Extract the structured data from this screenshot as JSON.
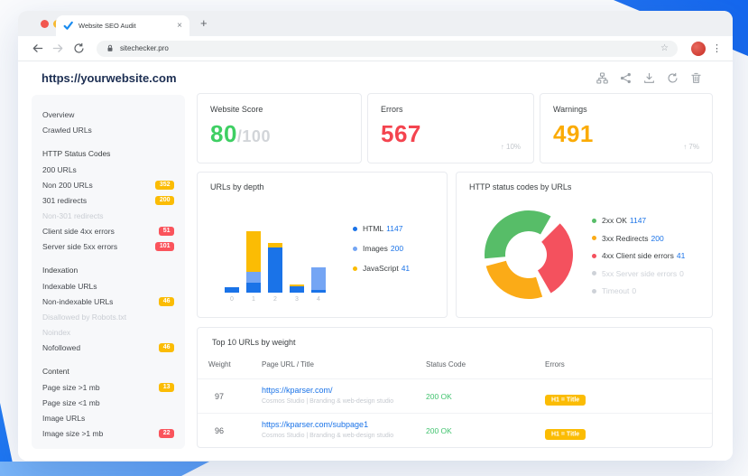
{
  "browser": {
    "tab": {
      "title": "Website SEO Audit",
      "close_icon": "×"
    },
    "new_tab_icon": "+",
    "address": {
      "url": "sitechecker.pro"
    },
    "menu_icon": "⋮"
  },
  "header": {
    "site_url": "https://yourwebsite.com",
    "action_icons": [
      "sitemap-icon",
      "share-icon",
      "download-icon",
      "refresh-icon",
      "trash-icon"
    ]
  },
  "sidebar": {
    "items": [
      {
        "label": "Overview",
        "type": "link"
      },
      {
        "label": "Crawled URLs",
        "type": "link"
      },
      {
        "label": "HTTP Status Codes",
        "type": "header"
      },
      {
        "label": "200 URLs",
        "type": "link"
      },
      {
        "label": "Non 200 URLs",
        "type": "link",
        "badge": "352",
        "badge_color": "orange"
      },
      {
        "label": "301 redirects",
        "type": "link",
        "badge": "200",
        "badge_color": "orange"
      },
      {
        "label": "Non-301 redirects",
        "type": "link",
        "disabled": true
      },
      {
        "label": "Client side 4xx errors",
        "type": "link",
        "badge": "51",
        "badge_color": "red"
      },
      {
        "label": "Server side 5xx errors",
        "type": "link",
        "badge": "101",
        "badge_color": "red"
      },
      {
        "label": "Indexation",
        "type": "header"
      },
      {
        "label": "Indexable URLs",
        "type": "link"
      },
      {
        "label": "Non-indexable URLs",
        "type": "link",
        "badge": "46",
        "badge_color": "orange"
      },
      {
        "label": "Disallowed by Robots.txt",
        "type": "link",
        "disabled": true
      },
      {
        "label": "Noindex",
        "type": "link",
        "disabled": true
      },
      {
        "label": "Nofollowed",
        "type": "link",
        "badge": "46",
        "badge_color": "orange"
      },
      {
        "label": "Content",
        "type": "header"
      },
      {
        "label": "Page size >1 mb",
        "type": "link",
        "badge": "13",
        "badge_color": "orange"
      },
      {
        "label": "Page size <1 mb",
        "type": "link"
      },
      {
        "label": "Image URLs",
        "type": "link"
      },
      {
        "label": "Image size >1 mb",
        "type": "link",
        "badge": "22",
        "badge_color": "red"
      }
    ]
  },
  "stats": {
    "cards": [
      {
        "label": "Website Score",
        "value": "80",
        "suffix": "/100",
        "color": "#3ecf63"
      },
      {
        "label": "Errors",
        "value": "567",
        "delta": "↑ 10%",
        "color": "#f4444f"
      },
      {
        "label": "Warnings",
        "value": "491",
        "delta": "↑ 7%",
        "color": "#fbab05"
      }
    ]
  },
  "chart_data": [
    {
      "type": "bar",
      "stacked": true,
      "title": "URLs by depth",
      "categories": [
        "0",
        "1",
        "2",
        "3",
        "4"
      ],
      "series": [
        {
          "name": "HTML",
          "legend_value": 1147,
          "color": "#1a73e8",
          "values": [
            6,
            11,
            50,
            7,
            3
          ]
        },
        {
          "name": "Images",
          "legend_value": 200,
          "color": "#74a5f4",
          "values": [
            0,
            12,
            0,
            0,
            25
          ]
        },
        {
          "name": "JavaScript",
          "legend_value": 41,
          "color": "#fbbc04",
          "values": [
            0,
            45,
            5,
            2,
            0
          ]
        }
      ],
      "value_unit": "approx px heights (bars carry no numeric labels in UI)",
      "legend_position": "right",
      "x_ticks": [
        "0",
        "1",
        "2",
        "3",
        "4"
      ],
      "grid": false
    },
    {
      "type": "pie",
      "subtype": "donut",
      "title": "HTTP status codes by URLs",
      "segments": [
        {
          "label": "2xx OK",
          "value": 1147,
          "color": "#57bd68"
        },
        {
          "label": "3xx Redirects",
          "value": 200,
          "color": "#fbab17"
        },
        {
          "label": "4xx Client side errors",
          "value": 41,
          "color": "#f4515e"
        },
        {
          "label": "5xx Server side errors",
          "value": 0,
          "color": "#ced2d8"
        },
        {
          "label": "Timeout",
          "value": 0,
          "color": "#ced2d8"
        }
      ],
      "legend_position": "right"
    }
  ],
  "table": {
    "title": "Top 10 URLs by weight",
    "columns": [
      "Weight",
      "Page URL / Title",
      "Status Code",
      "Errors"
    ],
    "rows": [
      {
        "weight": "97",
        "url": "https://kparser.com/",
        "page_title": "Cosmos Studio | Branding & web-design studio",
        "status": "200 OK",
        "error_badges": [
          "H1 = Title"
        ]
      },
      {
        "weight": "96",
        "url": "https://kparser.com/subpage1",
        "page_title": "Cosmos Studio | Branding & web-design studio",
        "status": "200 OK",
        "error_badges": [
          "H1 = Title"
        ]
      }
    ]
  },
  "colors": {
    "accent_blue": "#1a73e8",
    "link_blue": "#1a73e8",
    "score_green": "#3ecf63",
    "errors_red": "#f4444f",
    "warnings_orange": "#fbab05",
    "badge_orange": "#fbbc04",
    "badge_red": "#fa545c",
    "status_green": "#41c36f",
    "navy_title": "#1c2e52",
    "decor_blue": "#1668ee"
  }
}
